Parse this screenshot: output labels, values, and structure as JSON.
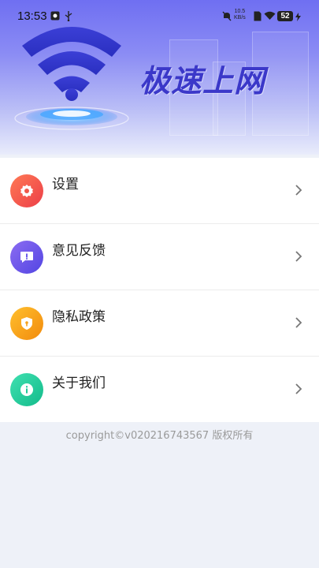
{
  "status_bar": {
    "time": "13:53",
    "net_speed_value": "10.5",
    "net_speed_unit": "KB/s",
    "battery": "52"
  },
  "header": {
    "title": "极速上网",
    "illustration": "wifi-icon"
  },
  "menu": {
    "items": [
      {
        "label": "设置",
        "icon": "gear-icon",
        "color": "#f0584a"
      },
      {
        "label": "意见反馈",
        "icon": "feedback-icon",
        "color": "#6b5bea"
      },
      {
        "label": "隐私政策",
        "icon": "shield-icon",
        "color": "#f7a21b"
      },
      {
        "label": "关于我们",
        "icon": "info-icon",
        "color": "#1fc99a"
      }
    ]
  },
  "footer": {
    "copyright": "copyright©v020216743567 版权所有"
  }
}
